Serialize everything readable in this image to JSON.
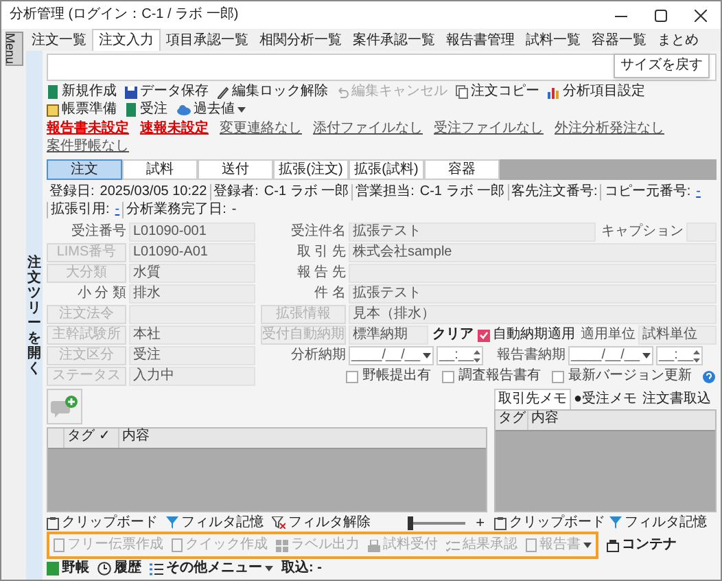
{
  "window": {
    "title": "分析管理 (ログイン：C-1 / ラボ 一郎)"
  },
  "menu_button": "Menu",
  "tabs": [
    {
      "label": "注文一覧",
      "selected": false
    },
    {
      "label": "注文入力",
      "selected": true
    },
    {
      "label": "項目承認一覧",
      "selected": false
    },
    {
      "label": "相関分析一覧",
      "selected": false
    },
    {
      "label": "案件承認一覧",
      "selected": false
    },
    {
      "label": "報告書管理",
      "selected": false
    },
    {
      "label": "試料一覧",
      "selected": false
    },
    {
      "label": "容器一覧",
      "selected": false
    },
    {
      "label": "まとめ",
      "selected": false
    }
  ],
  "tooltip": "サイズを戻す",
  "tree_toggle": "注文ツリーを開く",
  "toolbar": [
    {
      "label": "新規作成",
      "disabled": false,
      "dropdown": false
    },
    {
      "label": "データ保存",
      "disabled": false,
      "dropdown": false
    },
    {
      "label": "編集ロック解除",
      "disabled": false,
      "dropdown": false
    },
    {
      "label": "編集キャンセル",
      "disabled": true,
      "dropdown": false
    },
    {
      "label": "注文コピー",
      "disabled": false,
      "dropdown": false
    },
    {
      "label": "分析項目設定",
      "disabled": false,
      "dropdown": false
    },
    {
      "label": "帳票準備",
      "disabled": false,
      "dropdown": false
    },
    {
      "label": "受注",
      "disabled": false,
      "dropdown": false
    },
    {
      "label": "過去値",
      "disabled": false,
      "dropdown": true
    }
  ],
  "status_links": [
    {
      "label": "報告書未設定",
      "alert": true
    },
    {
      "label": "速報未設定",
      "alert": true
    },
    {
      "label": "変更連絡なし",
      "alert": false
    },
    {
      "label": "添付ファイルなし",
      "alert": false
    },
    {
      "label": "受注ファイルなし",
      "alert": false
    },
    {
      "label": "外注分析発注なし",
      "alert": false
    },
    {
      "label": "案件野帳なし",
      "alert": false
    }
  ],
  "subtabs": [
    {
      "label": "注文",
      "selected": true
    },
    {
      "label": "試料",
      "selected": false
    },
    {
      "label": "送付",
      "selected": false
    },
    {
      "label": "拡張(注文)",
      "selected": false
    },
    {
      "label": "拡張(試料)",
      "selected": false
    },
    {
      "label": "容器",
      "selected": false
    }
  ],
  "info": [
    {
      "title": "登録日:",
      "text": "2025/03/05 10:22",
      "link": false
    },
    {
      "title": "登録者:",
      "text": "C-1 ラボ 一郎",
      "link": false
    },
    {
      "title": "営業担当:",
      "text": "C-1 ラボ 一郎",
      "link": false
    },
    {
      "title": "客先注文番号:"
    },
    {
      "title": "コピー元番号:",
      "text": "-",
      "link": true
    },
    {
      "title": "拡張引用:",
      "text": "-",
      "link": true
    },
    {
      "title": "分析業務完了日:",
      "text": "-",
      "link": false
    }
  ],
  "left_fields": [
    {
      "kind": "label",
      "label": "受注番号",
      "value": "L01090-001"
    },
    {
      "kind": "button",
      "label": "LIMS番号",
      "value": "L01090-A01"
    },
    {
      "kind": "button",
      "label": "大分類",
      "value": "水質"
    },
    {
      "kind": "label",
      "label": "小 分 類",
      "value": "排水"
    },
    {
      "kind": "button",
      "label": "注文法令"
    },
    {
      "kind": "button",
      "label": "主幹試験所",
      "value": "本社"
    },
    {
      "kind": "button",
      "label": "注文区分",
      "value": "受注"
    },
    {
      "kind": "button",
      "label": "ステータス",
      "value": "入力中"
    }
  ],
  "right_form": {
    "order_title": {
      "label": "受注件名",
      "value": "拡張テスト"
    },
    "caption": {
      "label": "キャプション"
    },
    "client": {
      "label": "取 引 先",
      "value": "株式会社sample"
    },
    "report_to": {
      "label": "報 告 先"
    },
    "subject": {
      "label": "件 名",
      "value": "拡張テスト"
    },
    "extension": {
      "label": "拡張情報",
      "value": "見本（排水）"
    },
    "auto_due": {
      "label": "受付自動納期",
      "value": "標準納期",
      "clear": "クリア",
      "apply": {
        "label": "自動納期適用",
        "checked": true
      },
      "unit_label": "適用単位",
      "unit_value": "試料単位"
    },
    "analysis_due": {
      "label": "分析納期",
      "date": "____/__/__",
      "time": "__:__"
    },
    "report_due": {
      "label": "報告書納期",
      "date": "____/__/__",
      "time": "__:__"
    },
    "checkboxes": [
      {
        "label": "野帳提出有",
        "checked": false
      },
      {
        "label": "調査報告書有",
        "checked": false
      },
      {
        "label": "最新バージョン更新",
        "checked": false
      }
    ]
  },
  "tag_grid": {
    "columns": [
      "タグ ✓",
      "内容"
    ]
  },
  "memo": {
    "tabs": [
      {
        "label": "取引先メモ",
        "selected": true
      },
      {
        "label": "●受注メモ",
        "selected": false
      },
      {
        "label": "注文書取込",
        "selected": false
      }
    ],
    "columns": [
      "タグ",
      "内容"
    ]
  },
  "grid_footer": {
    "left": [
      "クリップボード",
      "フィルタ記憶",
      "フィルタ解除"
    ],
    "zoom": {
      "level": 0,
      "plus": "+"
    },
    "right": [
      "クリップボード",
      "フィルタ記憶"
    ]
  },
  "framed_tools": [
    {
      "label": "フリー伝票作成",
      "disabled": true,
      "dropdown": false
    },
    {
      "label": "クイック作成",
      "disabled": true,
      "dropdown": false
    },
    {
      "label": "ラベル出力",
      "disabled": true,
      "dropdown": false
    },
    {
      "label": "試料受付",
      "disabled": true,
      "dropdown": false
    },
    {
      "label": "結果承認",
      "disabled": true,
      "dropdown": false
    },
    {
      "label": "報告書",
      "disabled": true,
      "dropdown": true
    }
  ],
  "tools": [
    {
      "label": "コンテナ",
      "disabled": false,
      "dropdown": false
    },
    {
      "label": "野帳",
      "disabled": false,
      "dropdown": false
    },
    {
      "label": "履歴",
      "disabled": false,
      "dropdown": false
    },
    {
      "label": "その他メニュー",
      "disabled": false,
      "dropdown": true
    },
    {
      "label": "取込: -",
      "disabled": false,
      "dropdown": false
    }
  ]
}
